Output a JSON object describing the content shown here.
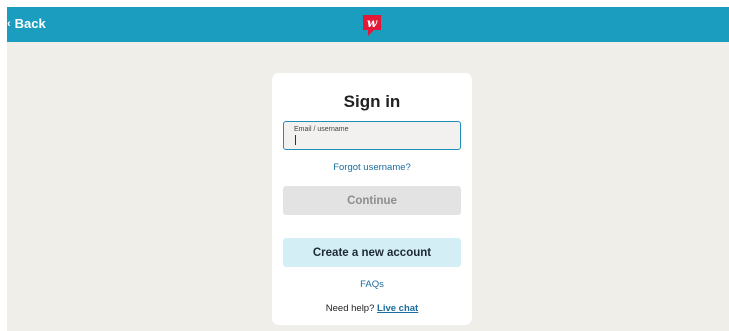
{
  "header": {
    "back_label": "Back",
    "logo_letter": "w",
    "brand_color": "#1b9dbf",
    "logo_color": "#e31837"
  },
  "signin": {
    "title": "Sign in",
    "email_label": "Email / username",
    "email_value": "",
    "forgot_label": "Forgot username?",
    "continue_label": "Continue",
    "create_account_label": "Create a new account",
    "faqs_label": "FAQs",
    "help_prefix": "Need help?",
    "live_chat_label": "Live chat"
  },
  "icons": {
    "back": "chevron-left-icon",
    "logo": "walgreens-logo"
  }
}
